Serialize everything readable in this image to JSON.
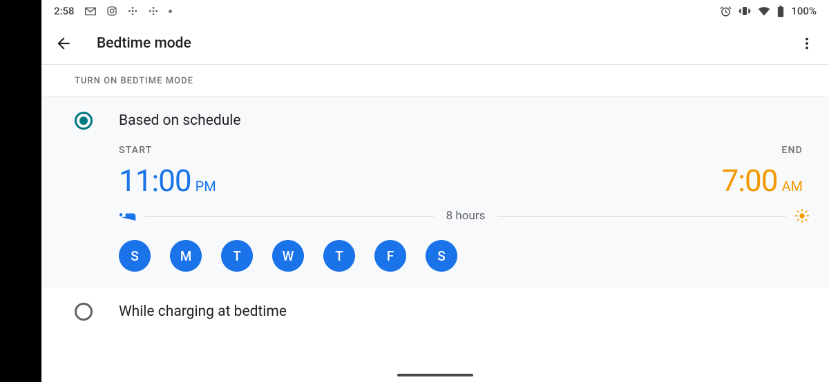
{
  "status": {
    "time": "2:58",
    "battery": "100%"
  },
  "header": {
    "title": "Bedtime mode"
  },
  "section_label": "TURN ON BEDTIME MODE",
  "option_schedule": {
    "title": "Based on schedule",
    "start_label": "START",
    "end_label": "END",
    "start_time": "11:00",
    "start_ampm": "PM",
    "end_time": "7:00",
    "end_ampm": "AM",
    "duration": "8 hours",
    "days": [
      "S",
      "M",
      "T",
      "W",
      "T",
      "F",
      "S"
    ]
  },
  "option_charging": {
    "title": "While charging at bedtime"
  },
  "colors": {
    "accent_teal": "#007982",
    "accent_blue": "#1a73e8",
    "accent_orange": "#f29900"
  }
}
